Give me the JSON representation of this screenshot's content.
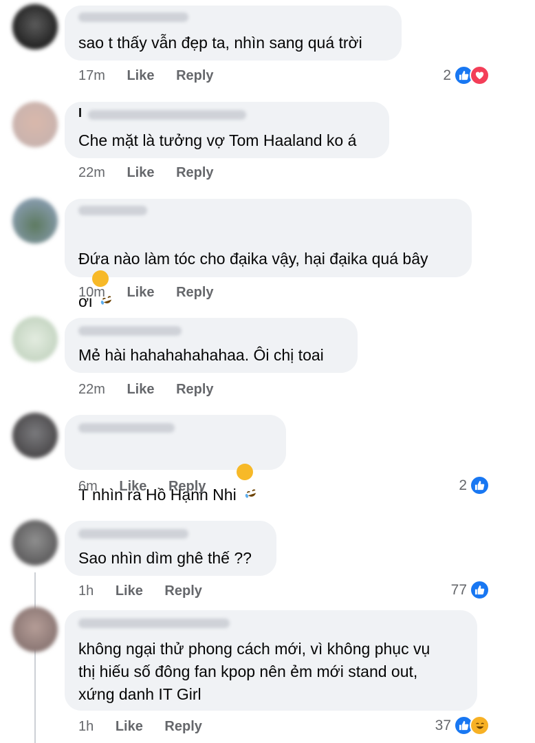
{
  "comments": [
    {
      "text": "sao t thấy vẫn đẹp ta, nhìn sang quá trời",
      "time": "17m",
      "like": "Like",
      "reply": "Reply",
      "count": "2",
      "reactions": [
        "like-icon",
        "love-icon"
      ]
    },
    {
      "name_initial": "I",
      "text": "Che mặt là tưởng vợ Tom Haaland ko á",
      "time": "22m",
      "like": "Like",
      "reply": "Reply"
    },
    {
      "text": "Đứa nào làm tóc cho đạika vậy, hại đạika quá bây\nơi",
      "time": "10m",
      "like": "Like",
      "reply": "Reply"
    },
    {
      "text": "Mẻ hài hahahahahahaa. Ôi chị toai",
      "time": "22m",
      "like": "Like",
      "reply": "Reply"
    },
    {
      "text": "T nhìn ra Hồ Hạnh Nhi",
      "time": "6m",
      "like": "Like",
      "reply": "Reply",
      "count": "2",
      "reactions": [
        "like-icon"
      ]
    },
    {
      "text": "Sao nhìn dìm ghê thế ??",
      "time": "1h",
      "like": "Like",
      "reply": "Reply",
      "count": "77",
      "reactions": [
        "like-icon"
      ]
    },
    {
      "text": "không ngại thử phong cách mới, vì không phục vụ\nthị hiếu số đông fan kpop nên ẻm mới stand out,\nxứng danh IT Girl",
      "time": "1h",
      "like": "Like",
      "reply": "Reply",
      "count": "37",
      "reactions": [
        "like-icon",
        "haha-icon"
      ]
    }
  ],
  "colors": {
    "bubble": "#f0f2f5",
    "meta": "#65676b",
    "like": "#1877f2",
    "love": "#f33e58",
    "haha": "#f7b125"
  }
}
